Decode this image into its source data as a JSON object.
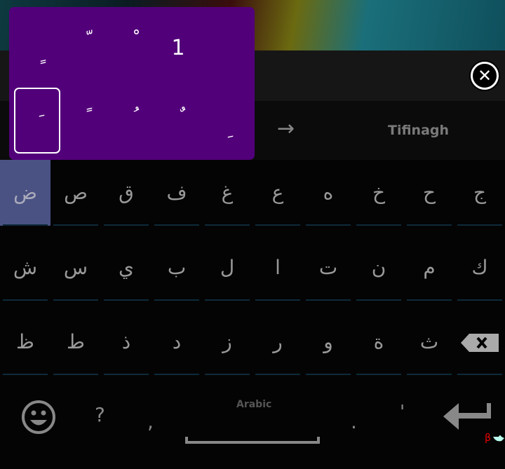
{
  "top_bar": {
    "close_icon": "close-circle-icon"
  },
  "candidates": {
    "arrow": "→",
    "next_layout": "Tifinagh"
  },
  "rows": [
    [
      "ض",
      "ص",
      "ق",
      "ف",
      "غ",
      "ع",
      "ه",
      "خ",
      "ح",
      "ج"
    ],
    [
      "ش",
      "س",
      "ي",
      "ب",
      "ل",
      "ا",
      "ت",
      "ن",
      "م",
      "ك"
    ],
    [
      "ظ",
      "ط",
      "ذ",
      "د",
      "ز",
      "ر",
      "و",
      "ة",
      "ث"
    ]
  ],
  "bottom": {
    "question": "?",
    "comma": ",",
    "space_label": "Arabic",
    "period": ".",
    "apostrophe": "'",
    "beta": "β"
  },
  "popup": {
    "row1": [
      "ٍ",
      "ّ",
      "ْ",
      "1"
    ],
    "row2": [
      "َ",
      "ً",
      "ُ",
      "ٌ",
      "ِ"
    ],
    "selected": "َ"
  },
  "colors": {
    "popup": "#52007a",
    "selected_key": "#4a5283"
  }
}
